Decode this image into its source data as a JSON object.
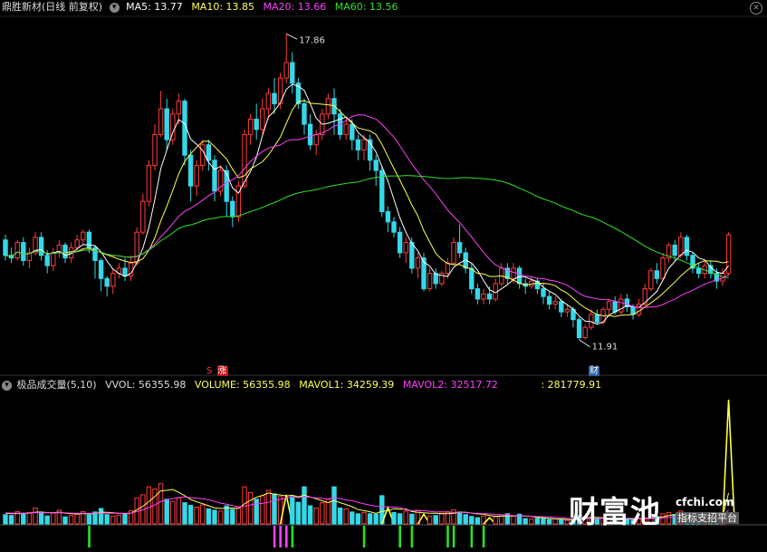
{
  "header": {
    "title": "鼎胜新材(日线 前复权)",
    "ma5": "MA5: 13.77",
    "ma10": "MA10: 13.85",
    "ma20": "MA20: 13.66",
    "ma60": "MA60: 13.56"
  },
  "sub_header": {
    "title": "极品成交量(5,10)",
    "vvol": "VVOL: 56355.98",
    "volume": "VOLUME: 56355.98",
    "mavol1": "MAVOL1: 34259.39",
    "mavol2": "MAVOL2: 32517.72",
    "extra": ": 281779.91"
  },
  "markers": {
    "high": "17.86",
    "low": "11.91",
    "zhang": "涨",
    "s": "S",
    "cai": "财"
  },
  "watermark": {
    "brand": "财富池",
    "site": "cfchi.com",
    "slogan": "指标支招平台"
  },
  "colors": {
    "up": "#ff3b3b",
    "down": "#35d8e8",
    "ma5": "#ffffff",
    "ma10": "#ffff55",
    "ma20": "#ff40ff",
    "ma60": "#30e030",
    "vol_up": "#ff3b3b",
    "vol_down": "#35d8e8",
    "vol_special": "#ffff40",
    "signal_green": "#28e028",
    "signal_magenta": "#ff40ff"
  },
  "chart_data": {
    "type": "candlestick",
    "price_range": [
      11.5,
      18.2
    ],
    "candles": [
      [
        13.85,
        13.55,
        13.95,
        13.45
      ],
      [
        13.55,
        13.5,
        13.7,
        13.4
      ],
      [
        13.5,
        13.8,
        13.85,
        13.45
      ],
      [
        13.8,
        13.45,
        13.9,
        13.35
      ],
      [
        13.45,
        13.6,
        13.7,
        13.3
      ],
      [
        13.6,
        13.9,
        14.0,
        13.55
      ],
      [
        13.9,
        13.55,
        14.0,
        13.45
      ],
      [
        13.55,
        13.35,
        13.65,
        13.2
      ],
      [
        13.35,
        13.6,
        13.7,
        13.25
      ],
      [
        13.6,
        13.75,
        13.85,
        13.5
      ],
      [
        13.75,
        13.5,
        13.8,
        13.4
      ],
      [
        13.5,
        13.7,
        13.8,
        13.4
      ],
      [
        13.7,
        13.85,
        13.95,
        13.6
      ],
      [
        13.85,
        14.0,
        14.05,
        13.75
      ],
      [
        14.0,
        13.7,
        14.05,
        13.6
      ],
      [
        13.7,
        13.45,
        13.75,
        13.1
      ],
      [
        13.45,
        13.1,
        13.5,
        12.85
      ],
      [
        13.1,
        12.95,
        13.15,
        12.75
      ],
      [
        12.95,
        13.2,
        13.3,
        12.8
      ],
      [
        13.2,
        13.3,
        13.4,
        13.1
      ],
      [
        13.3,
        13.15,
        13.5,
        13.05
      ],
      [
        13.15,
        13.4,
        13.55,
        13.05
      ],
      [
        13.4,
        14.0,
        14.1,
        13.35
      ],
      [
        14.0,
        14.6,
        14.75,
        13.95
      ],
      [
        14.6,
        15.3,
        15.4,
        14.5
      ],
      [
        15.3,
        15.9,
        16.1,
        15.2
      ],
      [
        15.9,
        16.4,
        16.75,
        15.85
      ],
      [
        16.4,
        15.8,
        16.6,
        15.6
      ],
      [
        15.8,
        16.3,
        16.4,
        15.7
      ],
      [
        16.3,
        16.55,
        16.7,
        16.1
      ],
      [
        16.55,
        15.5,
        16.6,
        15.3
      ],
      [
        15.5,
        14.9,
        15.6,
        14.6
      ],
      [
        14.9,
        15.3,
        15.4,
        14.7
      ],
      [
        15.3,
        15.7,
        15.8,
        15.2
      ],
      [
        15.7,
        15.4,
        15.8,
        15.2
      ],
      [
        15.4,
        14.8,
        15.5,
        14.6
      ],
      [
        14.8,
        15.2,
        15.3,
        14.7
      ],
      [
        15.2,
        14.6,
        15.3,
        14.3
      ],
      [
        14.6,
        14.3,
        14.7,
        14.1
      ],
      [
        14.3,
        14.9,
        15.0,
        14.2
      ],
      [
        14.9,
        15.9,
        16.0,
        14.85
      ],
      [
        15.9,
        16.2,
        16.3,
        15.7
      ],
      [
        16.2,
        16.0,
        16.5,
        15.8
      ],
      [
        16.0,
        16.4,
        16.6,
        15.9
      ],
      [
        16.4,
        16.7,
        16.8,
        16.2
      ],
      [
        16.7,
        16.5,
        17.0,
        16.3
      ],
      [
        16.5,
        17.0,
        17.1,
        16.4
      ],
      [
        17.0,
        17.3,
        17.86,
        16.9
      ],
      [
        17.3,
        16.9,
        17.5,
        16.7
      ],
      [
        16.9,
        16.5,
        17.0,
        16.4
      ],
      [
        16.5,
        16.1,
        16.6,
        15.9
      ],
      [
        16.1,
        15.7,
        16.3,
        15.6
      ],
      [
        15.7,
        15.9,
        16.0,
        15.5
      ],
      [
        15.9,
        16.3,
        16.4,
        15.8
      ],
      [
        16.3,
        16.6,
        16.7,
        16.2
      ],
      [
        16.6,
        16.3,
        16.8,
        15.9
      ],
      [
        16.3,
        15.9,
        16.4,
        15.8
      ],
      [
        15.9,
        16.1,
        16.2,
        15.8
      ],
      [
        16.1,
        15.8,
        16.2,
        15.6
      ],
      [
        15.8,
        15.6,
        15.9,
        15.4
      ],
      [
        15.6,
        15.8,
        15.9,
        15.4
      ],
      [
        15.8,
        15.4,
        15.9,
        15.2
      ],
      [
        15.4,
        15.2,
        15.5,
        14.9
      ],
      [
        15.2,
        14.4,
        15.3,
        14.3
      ],
      [
        14.4,
        14.2,
        14.5,
        14.0
      ],
      [
        14.2,
        14.0,
        14.3,
        13.9
      ],
      [
        14.0,
        13.6,
        14.1,
        13.5
      ],
      [
        13.6,
        13.8,
        13.9,
        13.4
      ],
      [
        13.8,
        13.3,
        13.9,
        13.2
      ],
      [
        13.3,
        13.5,
        13.6,
        13.1
      ],
      [
        13.5,
        12.9,
        13.6,
        12.85
      ],
      [
        12.9,
        13.2,
        13.3,
        12.85
      ],
      [
        13.2,
        13.0,
        13.3,
        12.9
      ],
      [
        13.0,
        13.2,
        13.25,
        12.95
      ],
      [
        13.2,
        13.4,
        13.5,
        13.1
      ],
      [
        13.4,
        13.8,
        13.9,
        13.35
      ],
      [
        13.8,
        13.6,
        14.15,
        13.5
      ],
      [
        13.6,
        13.3,
        13.7,
        13.2
      ],
      [
        13.3,
        12.9,
        13.4,
        12.8
      ],
      [
        12.9,
        12.7,
        13.0,
        12.6
      ],
      [
        12.7,
        12.8,
        12.9,
        12.6
      ],
      [
        12.8,
        12.7,
        12.95,
        12.6
      ],
      [
        12.7,
        13.0,
        13.1,
        12.65
      ],
      [
        13.0,
        13.3,
        13.4,
        12.95
      ],
      [
        13.3,
        13.1,
        13.4,
        13.0
      ],
      [
        13.1,
        13.3,
        13.4,
        13.0
      ],
      [
        13.3,
        13.0,
        13.35,
        12.9
      ],
      [
        13.0,
        12.95,
        13.1,
        12.8
      ],
      [
        12.95,
        13.05,
        13.15,
        12.9
      ],
      [
        13.05,
        12.9,
        13.1,
        12.8
      ],
      [
        12.9,
        12.75,
        13.0,
        12.6
      ],
      [
        12.75,
        12.6,
        12.85,
        12.5
      ],
      [
        12.6,
        12.65,
        12.75,
        12.5
      ],
      [
        12.65,
        12.45,
        12.7,
        12.35
      ],
      [
        12.45,
        12.5,
        12.6,
        12.35
      ],
      [
        12.5,
        12.3,
        12.55,
        12.15
      ],
      [
        12.3,
        11.95,
        12.35,
        11.91
      ],
      [
        11.95,
        12.15,
        12.2,
        11.91
      ],
      [
        12.15,
        12.4,
        12.5,
        12.1
      ],
      [
        12.4,
        12.25,
        12.5,
        12.2
      ],
      [
        12.25,
        12.5,
        12.55,
        12.2
      ],
      [
        12.5,
        12.65,
        12.7,
        12.4
      ],
      [
        12.65,
        12.45,
        12.75,
        12.4
      ],
      [
        12.45,
        12.7,
        12.8,
        12.4
      ],
      [
        12.7,
        12.55,
        12.8,
        12.45
      ],
      [
        12.55,
        12.4,
        12.6,
        12.3
      ],
      [
        12.4,
        12.6,
        12.7,
        12.35
      ],
      [
        12.6,
        12.9,
        13.0,
        12.55
      ],
      [
        12.9,
        13.25,
        13.3,
        12.85
      ],
      [
        13.25,
        13.1,
        13.4,
        13.0
      ],
      [
        13.1,
        13.5,
        13.6,
        13.05
      ],
      [
        13.5,
        13.75,
        13.8,
        13.4
      ],
      [
        13.75,
        13.55,
        13.85,
        13.45
      ],
      [
        13.55,
        13.9,
        14.0,
        13.5
      ],
      [
        13.9,
        13.55,
        13.95,
        13.45
      ],
      [
        13.55,
        13.3,
        13.6,
        13.2
      ],
      [
        13.3,
        13.2,
        13.4,
        13.1
      ],
      [
        13.2,
        13.35,
        13.45,
        13.1
      ],
      [
        13.35,
        13.2,
        13.45,
        13.1
      ],
      [
        13.2,
        13.05,
        13.3,
        12.9
      ],
      [
        13.05,
        13.2,
        13.3,
        12.95
      ],
      [
        13.2,
        13.95,
        14.0,
        13.15
      ]
    ],
    "volume_range": [
      0,
      60000
    ],
    "volume": [
      4200,
      3800,
      5600,
      4600,
      5200,
      7200,
      4800,
      3600,
      4900,
      6200,
      3200,
      3800,
      4400,
      5600,
      4200,
      5400,
      7000,
      4200,
      3600,
      4000,
      4400,
      6000,
      11800,
      13200,
      16800,
      15800,
      18200,
      11200,
      10200,
      11800,
      9600,
      8400,
      7600,
      8600,
      6800,
      6200,
      5800,
      8200,
      6600,
      7800,
      16800,
      14200,
      11200,
      12800,
      15200,
      13600,
      12400,
      13200,
      12400,
      9800,
      16800,
      8200,
      7200,
      9600,
      11200,
      16800,
      7200,
      6800,
      5400,
      4600,
      5200,
      4600,
      4400,
      12800,
      7400,
      5200,
      4600,
      5800,
      4400,
      6200,
      4400,
      3600,
      3800,
      4800,
      5600,
      6400,
      5400,
      4200,
      3400,
      2800,
      3600,
      2800,
      3200,
      4200,
      4600,
      3600,
      4400,
      2400,
      2200,
      2600,
      2400,
      2000,
      2200,
      1800,
      1600,
      2000,
      3800,
      3200,
      2600,
      2200,
      2800,
      2400,
      2000,
      2600,
      2200,
      1800,
      2400,
      2800,
      3600,
      3400,
      4600,
      5200,
      4200,
      5800,
      4000,
      3400,
      3000,
      3800,
      3200,
      3000,
      3600,
      56355.98
    ],
    "special_volume_indices": [
      47,
      64,
      70,
      81,
      121
    ],
    "mavol1": [
      4800,
      4600,
      4700,
      4800,
      4900,
      5300,
      5400,
      5100,
      5100,
      5300,
      4900,
      4600,
      4500,
      4700,
      4600,
      4700,
      5300,
      5200,
      5000,
      4800,
      4700,
      4800,
      6400,
      8000,
      10100,
      12400,
      15000,
      15200,
      15600,
      14300,
      12800,
      11100,
      10000,
      9200,
      8200,
      7300,
      7000,
      7200,
      7200,
      7000,
      9100,
      10700,
      12100,
      12900,
      14000,
      13400,
      13100,
      12700,
      13000,
      12300,
      13000,
      12200,
      11400,
      10500,
      9600,
      10600,
      9600,
      8800,
      7800,
      6500,
      6000,
      5500,
      4800,
      5700,
      6000,
      6900,
      6600,
      6800,
      5600,
      5200,
      5000,
      4800,
      4800,
      4600,
      4600,
      4800,
      5200,
      5300,
      4900,
      4500,
      4400,
      3800,
      3500,
      3500,
      3700,
      3600,
      3700,
      3500,
      3400,
      3000,
      2800,
      2500,
      2300,
      2200,
      2000,
      1900,
      2300,
      2700,
      2900,
      2900,
      2700,
      2600,
      2500,
      2500,
      2400,
      2200,
      2300,
      2400,
      2600,
      2800,
      3200,
      3800,
      4200,
      4600,
      4600,
      4700,
      4400,
      4400,
      3900,
      3500,
      3300,
      14000
    ],
    "mavol2": [
      5000,
      4900,
      4900,
      4900,
      5000,
      5100,
      5100,
      5000,
      5000,
      5100,
      5000,
      4900,
      4800,
      4800,
      4800,
      4800,
      4900,
      4900,
      4800,
      4800,
      4800,
      4900,
      5600,
      6400,
      7400,
      8600,
      10100,
      10900,
      11500,
      11900,
      12200,
      11900,
      11700,
      11400,
      10900,
      10200,
      9400,
      8900,
      8300,
      7700,
      8000,
      8600,
      9100,
      9300,
      9800,
      10600,
      11200,
      11700,
      12200,
      11800,
      12400,
      12100,
      11800,
      11600,
      11300,
      12000,
      11400,
      10900,
      10500,
      9800,
      9100,
      8500,
      8000,
      7800,
      7700,
      7600,
      7400,
      6400,
      6000,
      6100,
      6000,
      5700,
      5400,
      5500,
      5300,
      5200,
      5200,
      5100,
      4900,
      4800,
      4700,
      4500,
      4300,
      4100,
      4000,
      3800,
      3700,
      3600,
      3500,
      3300,
      3300,
      3200,
      3000,
      2800,
      2600,
      2500,
      2500,
      2500,
      2600,
      2500,
      2500,
      2500,
      2500,
      2500,
      2600,
      2500,
      2400,
      2400,
      2500,
      2600,
      2700,
      2900,
      3100,
      3400,
      3500,
      3600,
      3700,
      3800,
      3800,
      3900,
      3900,
      6300
    ],
    "signals": [
      {
        "i": 14,
        "kind": "green"
      },
      {
        "i": 45,
        "kind": "magenta"
      },
      {
        "i": 46,
        "kind": "magenta"
      },
      {
        "i": 47,
        "kind": "magenta"
      },
      {
        "i": 48,
        "kind": "green"
      },
      {
        "i": 60,
        "kind": "green"
      },
      {
        "i": 66,
        "kind": "green"
      },
      {
        "i": 68,
        "kind": "green"
      },
      {
        "i": 74,
        "kind": "green"
      },
      {
        "i": 75,
        "kind": "green"
      },
      {
        "i": 78,
        "kind": "green"
      },
      {
        "i": 80,
        "kind": "green"
      }
    ],
    "high_label": {
      "value": 17.86,
      "index": 47
    },
    "low_label": {
      "value": 11.91,
      "index": 96
    }
  }
}
